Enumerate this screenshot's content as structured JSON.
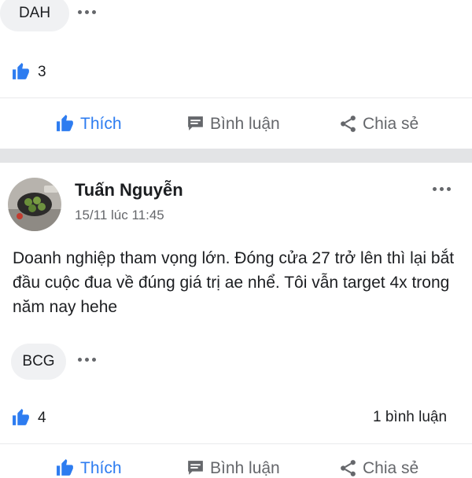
{
  "post1": {
    "tag": "DAH",
    "like_count": "3",
    "actions": {
      "like": "Thích",
      "comment": "Bình luận",
      "share": "Chia sẻ"
    }
  },
  "post2": {
    "author": "Tuấn Nguyễn",
    "timestamp": "15/11 lúc 11:45",
    "content": "Doanh nghiệp tham vọng lớn. Đóng cửa 27 trở lên thì lại bắt đầu cuộc đua về đúng giá trị ae nhể. Tôi vẫn target 4x trong năm nay hehe",
    "tag": "BCG",
    "like_count": "4",
    "comment_count": "1 bình luận",
    "actions": {
      "like": "Thích",
      "comment": "Bình luận",
      "share": "Chia sẻ"
    }
  },
  "colors": {
    "accent": "#2d7cf0",
    "muted": "#65676b",
    "chip_bg": "#f0f1f3",
    "separator": "#e3e4e6"
  },
  "icons": [
    "thumbs-up-icon",
    "comment-icon",
    "share-icon",
    "more-icon"
  ]
}
